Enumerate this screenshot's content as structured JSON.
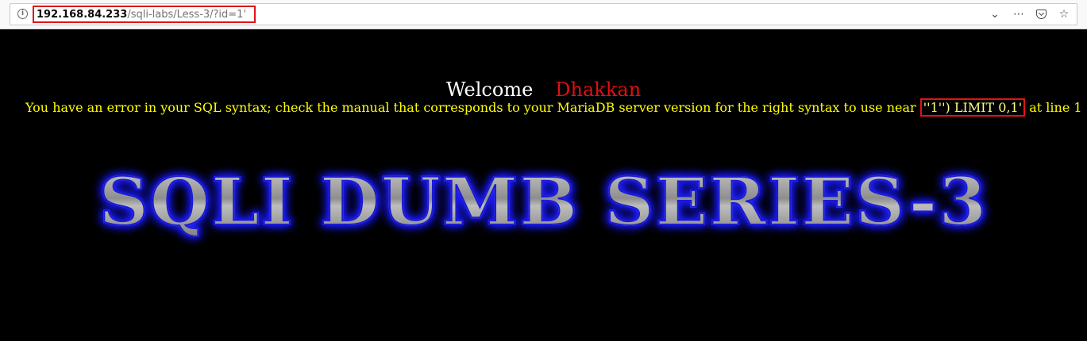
{
  "browser": {
    "url_host": "192.168.84.233",
    "url_path": "/sqli-labs/Less-3/?id=1'",
    "icons": [
      "info-icon",
      "chevron-down-icon",
      "more-icon",
      "pocket-icon",
      "star-icon"
    ]
  },
  "page": {
    "welcome": "Welcome",
    "name": "Dhakkan",
    "error_prefix": "You have an error in your SQL syntax; check the manual that corresponds to your MariaDB server version for the right syntax to use near ",
    "error_highlight": "''1'') LIMIT 0,1'",
    "error_suffix": " at line 1",
    "title_image_text": "SQLI DUMB SERIES-3"
  },
  "colors": {
    "background": "#000000",
    "error_text": "#ffff00",
    "name": "#e01010",
    "highlight_box": "#e0141b"
  }
}
